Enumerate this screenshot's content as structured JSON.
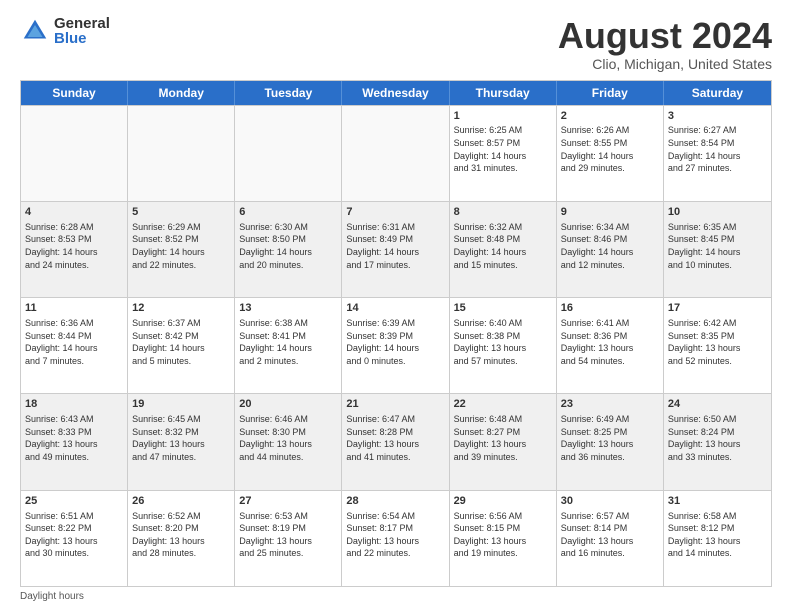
{
  "logo": {
    "general": "General",
    "blue": "Blue"
  },
  "title": "August 2024",
  "subtitle": "Clio, Michigan, United States",
  "dayHeaders": [
    "Sunday",
    "Monday",
    "Tuesday",
    "Wednesday",
    "Thursday",
    "Friday",
    "Saturday"
  ],
  "weeks": [
    [
      {
        "day": "",
        "info": "",
        "empty": true
      },
      {
        "day": "",
        "info": "",
        "empty": true
      },
      {
        "day": "",
        "info": "",
        "empty": true
      },
      {
        "day": "",
        "info": "",
        "empty": true
      },
      {
        "day": "1",
        "info": "Sunrise: 6:25 AM\nSunset: 8:57 PM\nDaylight: 14 hours\nand 31 minutes.",
        "empty": false
      },
      {
        "day": "2",
        "info": "Sunrise: 6:26 AM\nSunset: 8:55 PM\nDaylight: 14 hours\nand 29 minutes.",
        "empty": false
      },
      {
        "day": "3",
        "info": "Sunrise: 6:27 AM\nSunset: 8:54 PM\nDaylight: 14 hours\nand 27 minutes.",
        "empty": false
      }
    ],
    [
      {
        "day": "4",
        "info": "Sunrise: 6:28 AM\nSunset: 8:53 PM\nDaylight: 14 hours\nand 24 minutes.",
        "empty": false
      },
      {
        "day": "5",
        "info": "Sunrise: 6:29 AM\nSunset: 8:52 PM\nDaylight: 14 hours\nand 22 minutes.",
        "empty": false
      },
      {
        "day": "6",
        "info": "Sunrise: 6:30 AM\nSunset: 8:50 PM\nDaylight: 14 hours\nand 20 minutes.",
        "empty": false
      },
      {
        "day": "7",
        "info": "Sunrise: 6:31 AM\nSunset: 8:49 PM\nDaylight: 14 hours\nand 17 minutes.",
        "empty": false
      },
      {
        "day": "8",
        "info": "Sunrise: 6:32 AM\nSunset: 8:48 PM\nDaylight: 14 hours\nand 15 minutes.",
        "empty": false
      },
      {
        "day": "9",
        "info": "Sunrise: 6:34 AM\nSunset: 8:46 PM\nDaylight: 14 hours\nand 12 minutes.",
        "empty": false
      },
      {
        "day": "10",
        "info": "Sunrise: 6:35 AM\nSunset: 8:45 PM\nDaylight: 14 hours\nand 10 minutes.",
        "empty": false
      }
    ],
    [
      {
        "day": "11",
        "info": "Sunrise: 6:36 AM\nSunset: 8:44 PM\nDaylight: 14 hours\nand 7 minutes.",
        "empty": false
      },
      {
        "day": "12",
        "info": "Sunrise: 6:37 AM\nSunset: 8:42 PM\nDaylight: 14 hours\nand 5 minutes.",
        "empty": false
      },
      {
        "day": "13",
        "info": "Sunrise: 6:38 AM\nSunset: 8:41 PM\nDaylight: 14 hours\nand 2 minutes.",
        "empty": false
      },
      {
        "day": "14",
        "info": "Sunrise: 6:39 AM\nSunset: 8:39 PM\nDaylight: 14 hours\nand 0 minutes.",
        "empty": false
      },
      {
        "day": "15",
        "info": "Sunrise: 6:40 AM\nSunset: 8:38 PM\nDaylight: 13 hours\nand 57 minutes.",
        "empty": false
      },
      {
        "day": "16",
        "info": "Sunrise: 6:41 AM\nSunset: 8:36 PM\nDaylight: 13 hours\nand 54 minutes.",
        "empty": false
      },
      {
        "day": "17",
        "info": "Sunrise: 6:42 AM\nSunset: 8:35 PM\nDaylight: 13 hours\nand 52 minutes.",
        "empty": false
      }
    ],
    [
      {
        "day": "18",
        "info": "Sunrise: 6:43 AM\nSunset: 8:33 PM\nDaylight: 13 hours\nand 49 minutes.",
        "empty": false
      },
      {
        "day": "19",
        "info": "Sunrise: 6:45 AM\nSunset: 8:32 PM\nDaylight: 13 hours\nand 47 minutes.",
        "empty": false
      },
      {
        "day": "20",
        "info": "Sunrise: 6:46 AM\nSunset: 8:30 PM\nDaylight: 13 hours\nand 44 minutes.",
        "empty": false
      },
      {
        "day": "21",
        "info": "Sunrise: 6:47 AM\nSunset: 8:28 PM\nDaylight: 13 hours\nand 41 minutes.",
        "empty": false
      },
      {
        "day": "22",
        "info": "Sunrise: 6:48 AM\nSunset: 8:27 PM\nDaylight: 13 hours\nand 39 minutes.",
        "empty": false
      },
      {
        "day": "23",
        "info": "Sunrise: 6:49 AM\nSunset: 8:25 PM\nDaylight: 13 hours\nand 36 minutes.",
        "empty": false
      },
      {
        "day": "24",
        "info": "Sunrise: 6:50 AM\nSunset: 8:24 PM\nDaylight: 13 hours\nand 33 minutes.",
        "empty": false
      }
    ],
    [
      {
        "day": "25",
        "info": "Sunrise: 6:51 AM\nSunset: 8:22 PM\nDaylight: 13 hours\nand 30 minutes.",
        "empty": false
      },
      {
        "day": "26",
        "info": "Sunrise: 6:52 AM\nSunset: 8:20 PM\nDaylight: 13 hours\nand 28 minutes.",
        "empty": false
      },
      {
        "day": "27",
        "info": "Sunrise: 6:53 AM\nSunset: 8:19 PM\nDaylight: 13 hours\nand 25 minutes.",
        "empty": false
      },
      {
        "day": "28",
        "info": "Sunrise: 6:54 AM\nSunset: 8:17 PM\nDaylight: 13 hours\nand 22 minutes.",
        "empty": false
      },
      {
        "day": "29",
        "info": "Sunrise: 6:56 AM\nSunset: 8:15 PM\nDaylight: 13 hours\nand 19 minutes.",
        "empty": false
      },
      {
        "day": "30",
        "info": "Sunrise: 6:57 AM\nSunset: 8:14 PM\nDaylight: 13 hours\nand 16 minutes.",
        "empty": false
      },
      {
        "day": "31",
        "info": "Sunrise: 6:58 AM\nSunset: 8:12 PM\nDaylight: 13 hours\nand 14 minutes.",
        "empty": false
      }
    ]
  ],
  "footerNote": "Daylight hours"
}
